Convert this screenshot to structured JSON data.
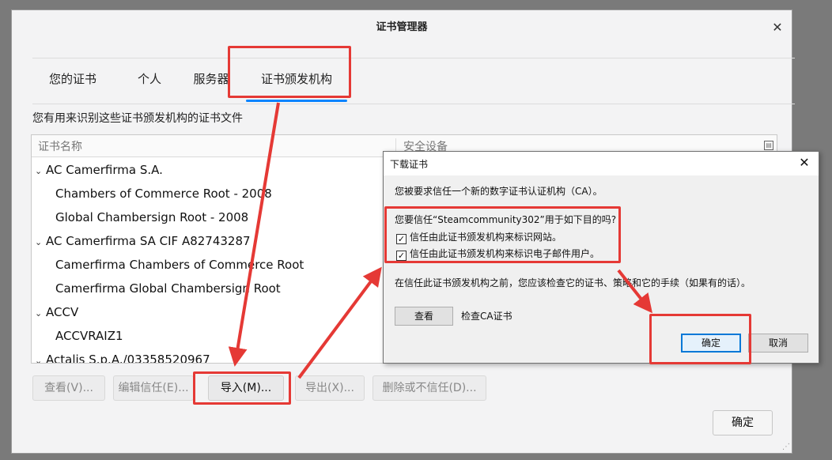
{
  "window": {
    "title": "证书管理器",
    "close": "✕"
  },
  "tabs": [
    "您的证书",
    "个人",
    "服务器",
    "证书颁发机构"
  ],
  "description": "您有用来识别这些证书颁发机构的证书文件",
  "tree": {
    "columns": [
      "证书名称",
      "安全设备"
    ],
    "rows": [
      {
        "label": "AC Camerfirma S.A.",
        "group": true
      },
      {
        "label": "Chambers of Commerce Root - 2008",
        "group": false
      },
      {
        "label": "Global Chambersign Root - 2008",
        "group": false
      },
      {
        "label": "AC Camerfirma SA CIF A82743287",
        "group": true
      },
      {
        "label": "Camerfirma Chambers of Commerce Root",
        "group": false
      },
      {
        "label": "Camerfirma Global Chambersign Root",
        "group": false
      },
      {
        "label": "ACCV",
        "group": true
      },
      {
        "label": "ACCVRAIZ1",
        "group": false
      },
      {
        "label": "Actalis S.p.A./03358520967",
        "group": true
      }
    ]
  },
  "buttons": {
    "view": "查看(V)...",
    "edit_trust": "编辑信任(E)...",
    "import": "导入(M)...",
    "export": "导出(X)...",
    "delete": "删除或不信任(D)...",
    "ok": "确定"
  },
  "dialog": {
    "title": "下载证书",
    "close": "✕",
    "intro": "您被要求信任一个新的数字证书认证机构（CA）。",
    "question": "您要信任“Steamcommunity302”用于如下目的吗?",
    "options": [
      {
        "label": "信任由此证书颁发机构来标识网站。",
        "checked": true
      },
      {
        "label": "信任由此证书颁发机构来标识电子邮件用户。",
        "checked": true
      }
    ],
    "advice": "在信任此证书颁发机构之前，您应该检查它的证书、策略和它的手续（如果有的话）。",
    "view_button": "查看",
    "view_hint": "检查CA证书",
    "ok_button": "确定",
    "cancel_button": "取消"
  },
  "annotation_color": "#e53935",
  "tab_indicator_color": "#0a84ff"
}
